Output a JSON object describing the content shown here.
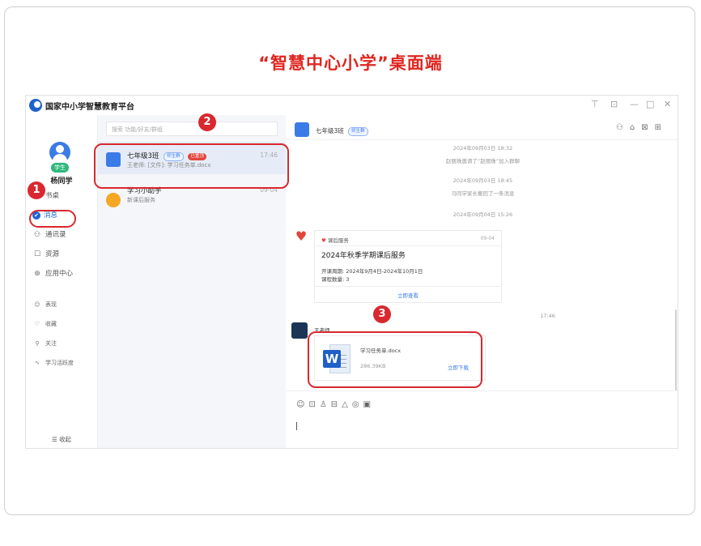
{
  "headline": "“智慧中心小学”桌面端",
  "app": {
    "title": "国家中小学智慧教育平台",
    "window_controls": [
      "⊤",
      "⊡",
      "—",
      "□",
      "✕"
    ]
  },
  "nav": {
    "role_badge": "学生",
    "user_name": "杨同学",
    "items": [
      {
        "label": "书桌",
        "icon": "desk-icon"
      },
      {
        "label": "消息",
        "icon": "message-icon"
      },
      {
        "label": "通讯录",
        "icon": "contacts-icon"
      },
      {
        "label": "资源",
        "icon": "resource-icon"
      },
      {
        "label": "应用中心",
        "icon": "app-center-icon"
      }
    ],
    "sub_items": [
      {
        "label": "表现",
        "icon": "smile-icon"
      },
      {
        "label": "收藏",
        "icon": "heart-icon"
      },
      {
        "label": "关注",
        "icon": "follow-icon"
      },
      {
        "label": "学习活跃度",
        "icon": "activity-icon"
      }
    ],
    "collapse_label": "收起"
  },
  "conversations": {
    "search_placeholder": "搜索 功能/好友/群组",
    "items": [
      {
        "name": "七年级3班",
        "tag1": "师生群",
        "tag2": "已置顶",
        "preview": "王老师: [文件]: 学习任务单.docx",
        "time": "17:46"
      },
      {
        "name": "学习小助手",
        "preview": "新课后服务",
        "time": "09-04"
      }
    ]
  },
  "chat": {
    "group_name": "七年级3班",
    "group_tag": "师生群",
    "header_icons": [
      "members-icon",
      "home-icon",
      "chart-icon",
      "settings-icon"
    ],
    "system_messages": [
      {
        "text": "2024年09月03日 18:32"
      },
      {
        "text": "赵丽珠邀请了“赵丽珠”加入群聊"
      },
      {
        "text": "2024年09月03日 18:45"
      },
      {
        "text": "马同学家长撤回了一条消息"
      },
      {
        "text": "2024年09月04日 15:26"
      }
    ],
    "service_card": {
      "source": "课后服务",
      "source_time": "09-04",
      "title": "2024年秋季学期课后服务",
      "line1": "开课周期: 2024年9月4日-2024年10月1日",
      "line2": "课程数量: 3",
      "action": "立即查看"
    },
    "file_time": "17:46",
    "sender_name": "王老师",
    "file": {
      "name": "学习任务单.docx",
      "size": "286.39KB",
      "action": "立即下载"
    },
    "toolbar_icons": [
      "☺",
      "⊡",
      "♙",
      "⊟",
      "△",
      "◎",
      "▣"
    ]
  },
  "markers": [
    "1",
    "2",
    "3"
  ]
}
